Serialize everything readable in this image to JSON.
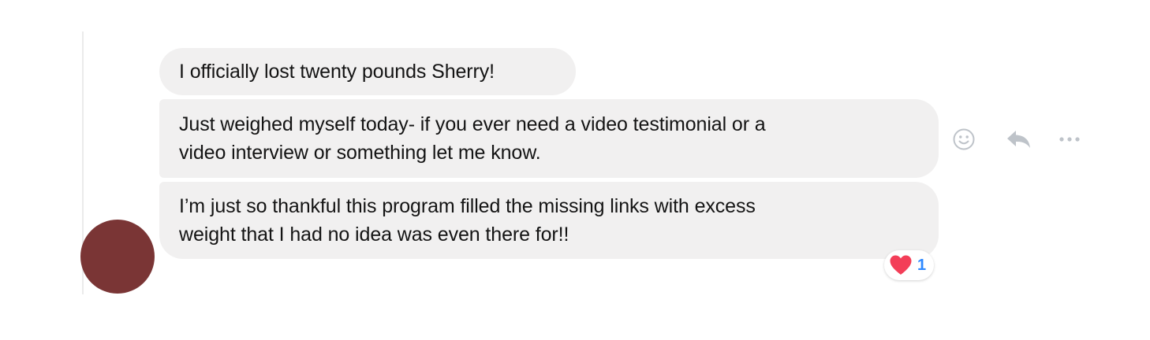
{
  "messages": [
    {
      "lines": [
        "I officially lost twenty pounds Sherry!"
      ]
    },
    {
      "lines": [
        "Just weighed myself today- if you ever need a video testimonial or a",
        "video interview or something let me know."
      ]
    },
    {
      "lines": [
        "I’m just so thankful this program filled the missing links with excess",
        "weight that I had no idea was even there for!!"
      ]
    }
  ],
  "actions": {
    "react_icon": "smiley-icon",
    "reply_icon": "reply-arrow-icon",
    "more_icon": "more-dots-icon"
  },
  "reaction": {
    "icon": "heart-icon",
    "count": "1"
  },
  "colors": {
    "bubble_background": "#f1f0f0",
    "avatar": "#7a3535",
    "reaction_count": "#2e89ff",
    "heart": "#f33e58",
    "action_icons": "#bec3c9"
  }
}
